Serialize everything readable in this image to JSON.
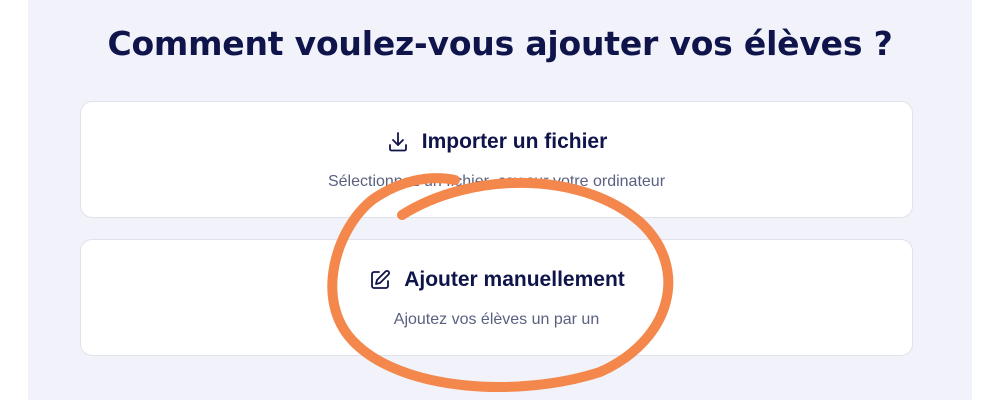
{
  "header": {
    "title": "Comment voulez-vous ajouter vos élèves ?"
  },
  "options": [
    {
      "icon": "download-icon",
      "title": "Importer un fichier",
      "subtitle": "Sélectionnez un fichier .csv sur votre ordinateur"
    },
    {
      "icon": "pencil-edit-icon",
      "title": "Ajouter manuellement",
      "subtitle": "Ajoutez vos élèves un par un"
    }
  ],
  "colors": {
    "panel_background": "#f2f3fa",
    "title_text": "#0f144a",
    "subtitle_text": "#5a6080",
    "annotation_circle": "#f4874b"
  }
}
